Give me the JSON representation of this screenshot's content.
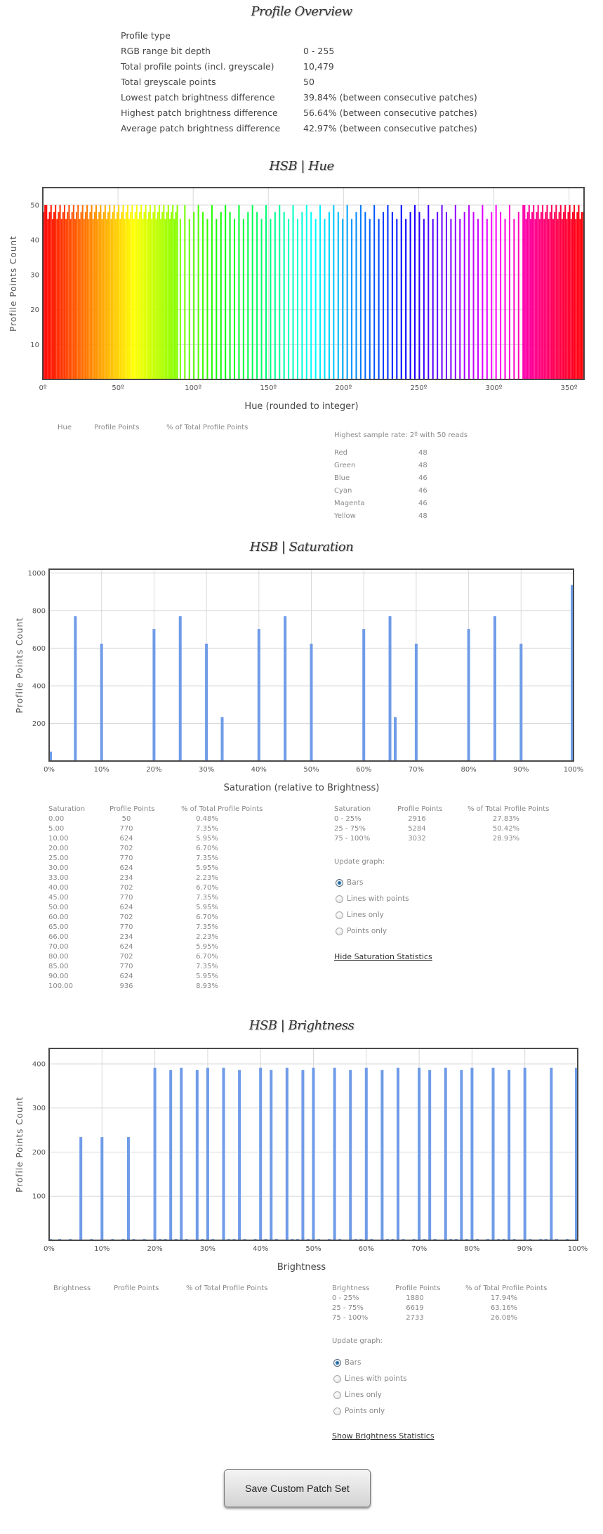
{
  "overview": {
    "title": "Profile Overview",
    "rows": [
      {
        "label": "Profile type",
        "value": ""
      },
      {
        "label": "RGB range bit depth",
        "value": "0 - 255"
      },
      {
        "label": "Total profile points (incl. greyscale)",
        "value": "10,479"
      },
      {
        "label": "Total greyscale points",
        "value": "50"
      },
      {
        "label": "Lowest patch brightness difference",
        "value": "39.84% (between consecutive patches)"
      },
      {
        "label": "Highest patch brightness difference",
        "value": "56.64% (between consecutive patches)"
      },
      {
        "label": "Average patch brightness difference",
        "value": "42.97% (between consecutive patches)"
      }
    ]
  },
  "hue_section": {
    "table_headers": [
      "Hue",
      "Profile Points",
      "% of Total Profile Points"
    ],
    "highest_sample": "Highest sample rate: 2º with 50 reads",
    "color_counts": [
      {
        "name": "Red",
        "value": "48"
      },
      {
        "name": "Green",
        "value": "48"
      },
      {
        "name": "Blue",
        "value": "46"
      },
      {
        "name": "Cyan",
        "value": "46"
      },
      {
        "name": "Magenta",
        "value": "46"
      },
      {
        "name": "Yellow",
        "value": "48"
      }
    ]
  },
  "saturation_section": {
    "table_headers": [
      "Saturation",
      "Profile Points",
      "% of Total Profile Points"
    ],
    "rows": [
      [
        "0.00",
        "50",
        "0.48%"
      ],
      [
        "5.00",
        "770",
        "7.35%"
      ],
      [
        "10.00",
        "624",
        "5.95%"
      ],
      [
        "20.00",
        "702",
        "6.70%"
      ],
      [
        "25.00",
        "770",
        "7.35%"
      ],
      [
        "30.00",
        "624",
        "5.95%"
      ],
      [
        "33.00",
        "234",
        "2.23%"
      ],
      [
        "40.00",
        "702",
        "6.70%"
      ],
      [
        "45.00",
        "770",
        "7.35%"
      ],
      [
        "50.00",
        "624",
        "5.95%"
      ],
      [
        "60.00",
        "702",
        "6.70%"
      ],
      [
        "65.00",
        "770",
        "7.35%"
      ],
      [
        "66.00",
        "234",
        "2.23%"
      ],
      [
        "70.00",
        "624",
        "5.95%"
      ],
      [
        "80.00",
        "702",
        "6.70%"
      ],
      [
        "85.00",
        "770",
        "7.35%"
      ],
      [
        "90.00",
        "624",
        "5.95%"
      ],
      [
        "100.00",
        "936",
        "8.93%"
      ]
    ],
    "range_headers": [
      "Saturation",
      "Profile Points",
      "% of Total Profile Points"
    ],
    "ranges": [
      [
        "0 - 25%",
        "2916",
        "27.83%"
      ],
      [
        "25 - 75%",
        "5284",
        "50.42%"
      ],
      [
        "75 - 100%",
        "3032",
        "28.93%"
      ]
    ],
    "update_label": "Update graph:",
    "options": [
      "Bars",
      "Lines with points",
      "Lines only",
      "Points only"
    ],
    "selected": "Bars",
    "toggle_link": "Hide Saturation Statistics"
  },
  "brightness_section": {
    "table_headers": [
      "Brightness",
      "Profile Points",
      "% of Total Profile Points"
    ],
    "range_headers": [
      "Brightness",
      "Profile Points",
      "% of Total Profile Points"
    ],
    "ranges": [
      [
        "0 - 25%",
        "1880",
        "17.94%"
      ],
      [
        "25 - 75%",
        "6619",
        "63.16%"
      ],
      [
        "75 - 100%",
        "2733",
        "26.08%"
      ]
    ],
    "update_label": "Update graph:",
    "options": [
      "Bars",
      "Lines with points",
      "Lines only",
      "Points only"
    ],
    "selected": "Bars",
    "toggle_link": "Show Brightness Statistics"
  },
  "save_button": "Save Custom Patch Set",
  "chart_data": [
    {
      "id": "hue",
      "type": "bar",
      "title": "HSB | Hue",
      "xlabel": "Hue (rounded to integer)",
      "ylabel": "Profile Points Count",
      "xlim": [
        0,
        360
      ],
      "ylim": [
        0,
        55
      ],
      "xticks": [
        0,
        50,
        100,
        150,
        200,
        250,
        300,
        350
      ],
      "xtick_labels": [
        "0º",
        "50º",
        "100º",
        "150º",
        "200º",
        "250º",
        "300º",
        "350º"
      ],
      "yticks": [
        10,
        20,
        30,
        40,
        50
      ],
      "grid": true,
      "bar_color": "hue-spectrum",
      "x": [
        0,
        1,
        2,
        3,
        4,
        5,
        6,
        7,
        8,
        9,
        10,
        11,
        12,
        13,
        14,
        15,
        16,
        17,
        18,
        19,
        20,
        21,
        22,
        23,
        24,
        25,
        26,
        27,
        28,
        29,
        30,
        31,
        32,
        33,
        34,
        35,
        36,
        37,
        38,
        39,
        40,
        41,
        42,
        43,
        44,
        45,
        46,
        47,
        48,
        49,
        50,
        51,
        52,
        53,
        54,
        55,
        56,
        57,
        58,
        59,
        60,
        61,
        62,
        63,
        64,
        65,
        66,
        67,
        68,
        69,
        70,
        71,
        72,
        73,
        74,
        75,
        76,
        77,
        78,
        79,
        80,
        81,
        82,
        83,
        84,
        85,
        86,
        87,
        88,
        89,
        91,
        94,
        97,
        100,
        103,
        106,
        109,
        112,
        115,
        118,
        121,
        124,
        127,
        130,
        133,
        136,
        139,
        142,
        145,
        148,
        151,
        154,
        157,
        160,
        163,
        166,
        169,
        172,
        175,
        178,
        181,
        184,
        187,
        190,
        193,
        196,
        199,
        202,
        205,
        208,
        211,
        214,
        217,
        220,
        223,
        226,
        229,
        232,
        235,
        238,
        241,
        244,
        247,
        250,
        253,
        256,
        259,
        262,
        265,
        268,
        271,
        274,
        277,
        280,
        283,
        286,
        289,
        292,
        295,
        298,
        301,
        304,
        307,
        310,
        313,
        316,
        319,
        320,
        321,
        322,
        323,
        324,
        325,
        326,
        327,
        328,
        329,
        330,
        331,
        332,
        333,
        334,
        335,
        336,
        337,
        338,
        339,
        340,
        341,
        342,
        343,
        344,
        345,
        346,
        347,
        348,
        349,
        350,
        351,
        352,
        353,
        354,
        355,
        356,
        357,
        358,
        359
      ],
      "y": [
        48,
        50,
        50,
        46,
        48,
        50,
        46,
        48,
        50,
        46,
        48,
        50,
        46,
        48,
        50,
        46,
        48,
        50,
        46,
        48,
        50,
        46,
        48,
        50,
        46,
        48,
        50,
        46,
        48,
        50,
        46,
        48,
        50,
        46,
        48,
        50,
        46,
        48,
        50,
        46,
        48,
        50,
        46,
        48,
        50,
        46,
        48,
        50,
        46,
        48,
        50,
        46,
        48,
        50,
        46,
        48,
        50,
        46,
        48,
        50,
        46,
        48,
        50,
        46,
        48,
        50,
        46,
        48,
        50,
        46,
        48,
        50,
        46,
        48,
        50,
        46,
        48,
        50,
        46,
        48,
        50,
        46,
        48,
        50,
        46,
        48,
        50,
        46,
        48,
        50,
        46,
        50,
        46,
        48,
        50,
        48,
        46,
        50,
        46,
        48,
        50,
        48,
        46,
        50,
        46,
        48,
        50,
        48,
        46,
        50,
        46,
        48,
        50,
        48,
        46,
        50,
        46,
        48,
        50,
        48,
        46,
        50,
        46,
        48,
        50,
        48,
        46,
        50,
        46,
        48,
        50,
        48,
        46,
        50,
        46,
        48,
        50,
        48,
        46,
        50,
        46,
        48,
        50,
        48,
        46,
        50,
        46,
        48,
        50,
        48,
        46,
        50,
        46,
        48,
        50,
        48,
        46,
        50,
        46,
        48,
        50,
        48,
        46,
        50,
        46,
        48,
        50,
        50,
        46,
        48,
        50,
        46,
        48,
        50,
        46,
        48,
        50,
        46,
        48,
        50,
        46,
        48,
        50,
        46,
        48,
        50,
        46,
        48,
        50,
        46,
        48,
        50,
        46,
        48,
        50,
        46,
        48,
        50,
        46,
        48,
        50,
        46,
        48,
        50,
        46,
        48,
        48
      ]
    },
    {
      "id": "saturation",
      "type": "bar",
      "title": "HSB | Saturation",
      "xlabel": "Saturation (relative to Brightness)",
      "ylabel": "Profile Points Count",
      "xlim": [
        0,
        100
      ],
      "ylim": [
        0,
        1020
      ],
      "xticks": [
        0,
        10,
        20,
        30,
        40,
        50,
        60,
        70,
        80,
        90,
        100
      ],
      "xtick_labels": [
        "0%",
        "10%",
        "20%",
        "30%",
        "40%",
        "50%",
        "60%",
        "70%",
        "80%",
        "90%",
        "100%"
      ],
      "yticks": [
        200,
        400,
        600,
        800,
        1000
      ],
      "grid": true,
      "bar_color": "#6f9be8",
      "x": [
        0,
        5,
        10,
        20,
        25,
        30,
        33,
        40,
        45,
        50,
        60,
        65,
        66,
        70,
        80,
        85,
        90,
        100
      ],
      "y": [
        50,
        770,
        624,
        702,
        770,
        624,
        234,
        702,
        770,
        624,
        702,
        770,
        234,
        624,
        702,
        770,
        624,
        936
      ]
    },
    {
      "id": "brightness",
      "type": "bar",
      "title": "HSB | Brightness",
      "xlabel": "Brightness",
      "ylabel": "Profile Points Count",
      "xlim": [
        0,
        100
      ],
      "ylim": [
        0,
        435
      ],
      "xticks": [
        0,
        10,
        20,
        30,
        40,
        50,
        60,
        70,
        80,
        90,
        100
      ],
      "xtick_labels": [
        "0%",
        "10%",
        "20%",
        "30%",
        "40%",
        "50%",
        "60%",
        "70%",
        "80%",
        "90%",
        "100%"
      ],
      "yticks": [
        100,
        200,
        300,
        400
      ],
      "grid": true,
      "bar_color": "#6f9be8",
      "x": [
        0,
        2,
        4,
        6,
        8,
        10,
        12,
        14,
        15,
        16,
        18,
        20,
        21,
        22,
        23,
        24,
        25,
        26,
        28,
        29,
        30,
        31,
        33,
        34,
        35,
        36,
        37,
        39,
        40,
        41,
        42,
        43,
        45,
        46,
        47,
        48,
        49,
        50,
        51,
        53,
        54,
        55,
        57,
        58,
        59,
        60,
        61,
        63,
        64,
        65,
        66,
        67,
        69,
        70,
        71,
        72,
        73,
        75,
        76,
        77,
        78,
        79,
        80,
        81,
        83,
        84,
        85,
        86,
        87,
        88,
        90,
        91,
        93,
        94,
        95,
        96,
        98,
        100
      ],
      "y": [
        3,
        3,
        3,
        234,
        3,
        234,
        3,
        3,
        234,
        3,
        3,
        391,
        3,
        3,
        386,
        3,
        391,
        3,
        386,
        3,
        391,
        3,
        391,
        3,
        3,
        386,
        3,
        3,
        391,
        3,
        386,
        3,
        391,
        3,
        3,
        386,
        3,
        391,
        3,
        3,
        391,
        3,
        386,
        3,
        3,
        391,
        3,
        386,
        3,
        3,
        391,
        3,
        3,
        391,
        3,
        386,
        3,
        391,
        3,
        3,
        386,
        3,
        391,
        3,
        3,
        391,
        3,
        3,
        386,
        3,
        391,
        3,
        3,
        3,
        391,
        3,
        3,
        391
      ]
    }
  ]
}
